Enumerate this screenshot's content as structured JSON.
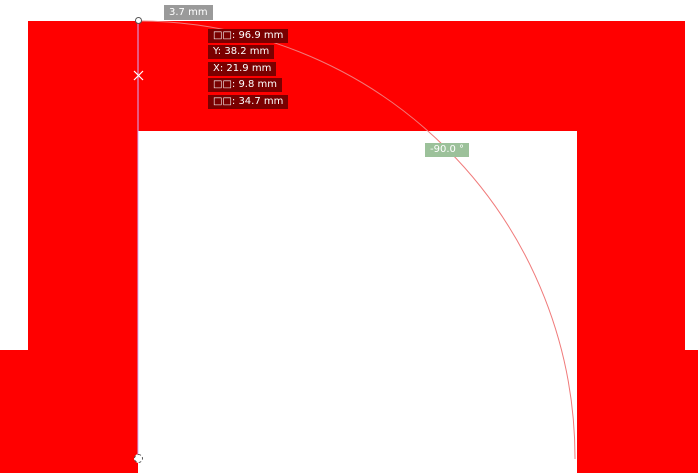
{
  "colors": {
    "shape_fill": "#ff0000",
    "tooltip_bg": "#7a0000",
    "length_badge_bg": "#9a9a9a",
    "angle_badge_bg": "#9cc19a",
    "arc_stroke": "#f07a7a",
    "guide_line": "#d0b0ff"
  },
  "measure": {
    "length": "3.7 mm",
    "angle": "-90.0 °"
  },
  "tooltip": {
    "rows": [
      "□□: 96.9 mm",
      "Y: 38.2 mm",
      "X: 21.9 mm",
      "□□: 9.8 mm",
      "□□: 34.7 mm"
    ]
  },
  "icons": {
    "start_handle": "circle-handle-icon",
    "end_handle": "square-handle-icon",
    "midpoint_marker": "cross-marker-icon"
  }
}
